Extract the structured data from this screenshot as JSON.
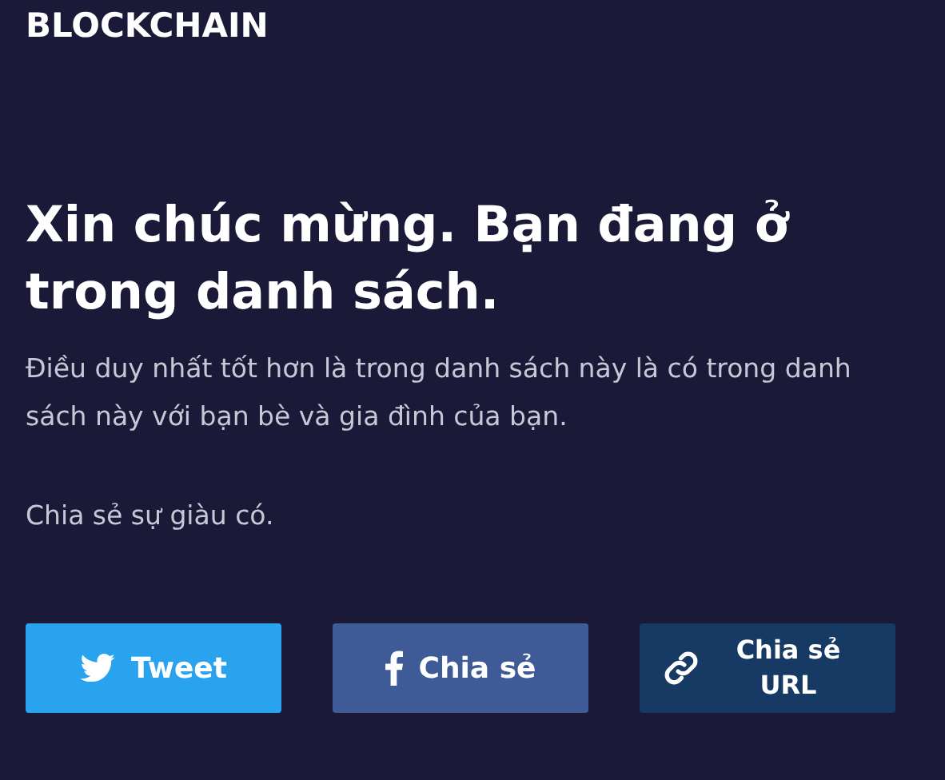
{
  "logo": "BLOCKCHAIN",
  "heading": "Xin chúc mừng. Bạn đang ở trong danh sách.",
  "description": "Điều duy nhất tốt hơn là trong danh sách này là có trong danh sách này với bạn bè và gia đình của bạn.",
  "share_prompt": "Chia sẻ sự giàu có.",
  "buttons": [
    {
      "kind": "twitter",
      "label": "Tweet"
    },
    {
      "kind": "facebook",
      "label": "Chia sẻ"
    },
    {
      "kind": "link",
      "label": "Chia sẻ URL"
    }
  ]
}
